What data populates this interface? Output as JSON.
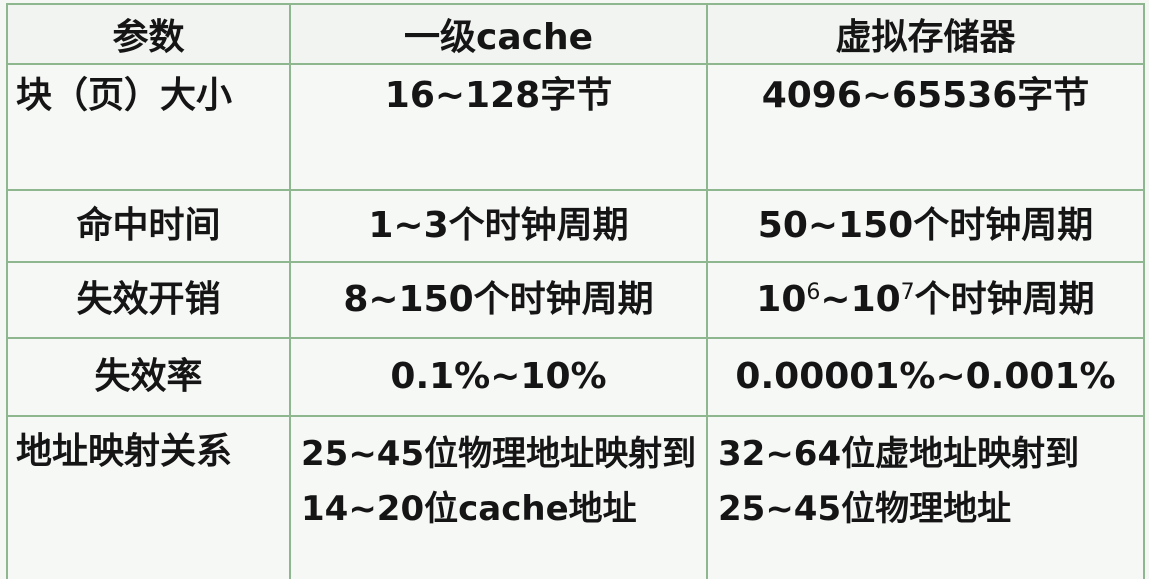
{
  "table": {
    "headers": [
      "参数",
      "一级cache",
      "虚拟存储器"
    ],
    "rows": [
      {
        "param": "块（页）大小",
        "cache": "16~128字节",
        "vm": "4096~65536字节"
      },
      {
        "param": "命中时间",
        "cache": "1~3个时钟周期",
        "vm": "50~150个时钟周期"
      },
      {
        "param": "失效开销",
        "cache": "8~150个时钟周期",
        "vm_base1": "10",
        "vm_exp1": "6",
        "vm_mid": "~10",
        "vm_exp2": "7",
        "vm_tail": "个时钟周期"
      },
      {
        "param": "失效率",
        "cache": "0.1%~10%",
        "vm": "0.00001%~0.001%"
      },
      {
        "param": "地址映射关系",
        "cache": "25~45位物理地址映射到14~20位cache地址",
        "vm": "32~64位虚地址映射到25~45位物理地址"
      }
    ]
  }
}
